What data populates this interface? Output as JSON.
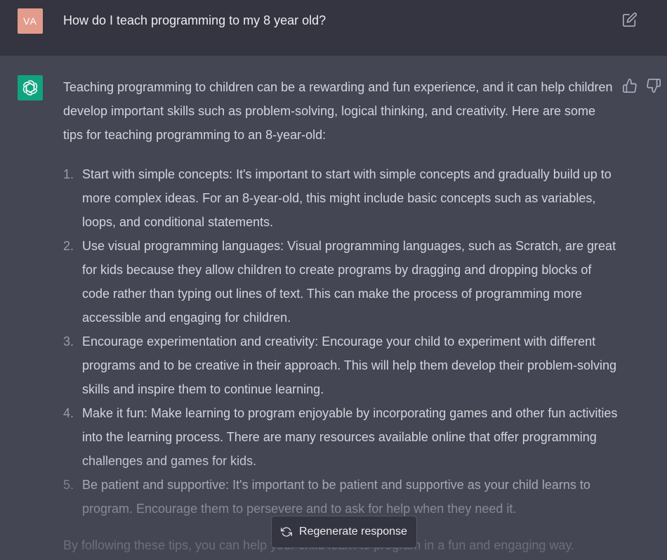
{
  "user_message": {
    "avatar_initials": "VA",
    "text": "How do I teach programming to my 8 year old?",
    "edit_icon": "edit-icon"
  },
  "assistant_message": {
    "avatar_icon": "openai-logo-icon",
    "intro": "Teaching programming to children can be a rewarding and fun experience, and it can help children develop important skills such as problem-solving, logical thinking, and creativity. Here are some tips for teaching programming to an 8-year-old:",
    "tips": [
      {
        "num": "1.",
        "text": "Start with simple concepts: It's important to start with simple concepts and gradually build up to more complex ideas. For an 8-year-old, this might include basic concepts such as variables, loops, and conditional statements."
      },
      {
        "num": "2.",
        "text": "Use visual programming languages: Visual programming languages, such as Scratch, are great for kids because they allow children to create programs by dragging and dropping blocks of code rather than typing out lines of text. This can make the process of programming more accessible and engaging for children."
      },
      {
        "num": "3.",
        "text": "Encourage experimentation and creativity: Encourage your child to experiment with different programs and to be creative in their approach. This will help them develop their problem-solving skills and inspire them to continue learning."
      },
      {
        "num": "4.",
        "text": "Make it fun: Make learning to program enjoyable by incorporating games and other fun activities into the learning process. There are many resources available online that offer programming challenges and games for kids."
      },
      {
        "num": "5.",
        "text": "Be patient and supportive: It's important to be patient and supportive as your child learns to program. Encourage them to persevere and to ask for help when they need it."
      }
    ],
    "conclusion": "By following these tips, you can help your child learn to program in a fun and engaging way.",
    "feedback_icons": [
      "thumbs-up-icon",
      "thumbs-down-icon"
    ]
  },
  "regenerate_button": {
    "label": "Regenerate response",
    "icon": "refresh-icon"
  },
  "colors": {
    "user_bg": "#343541",
    "assistant_bg": "#444654",
    "user_avatar": "#e39b8c",
    "bot_avatar": "#10a37f",
    "text": "#d1d5db"
  }
}
